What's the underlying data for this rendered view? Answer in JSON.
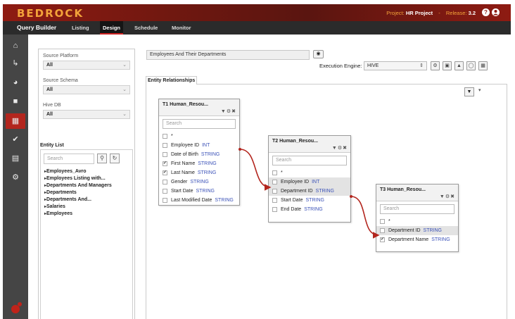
{
  "header": {
    "brand": "BEDROCK",
    "project_label": "Project:",
    "project_value": "HR Project",
    "separator": "-",
    "release_label": "Release:",
    "release_value": "3.2",
    "help_icon": "?",
    "user_icon": "user-icon"
  },
  "nav": {
    "title": "Query Builder",
    "tabs": [
      "Listing",
      "Design",
      "Schedule",
      "Monitor"
    ],
    "active": "Design"
  },
  "sidebar": {
    "icons": [
      "home-icon",
      "lineage-icon",
      "dashboard-icon",
      "folder-icon",
      "grid-icon",
      "check-icon",
      "clipboard-icon",
      "gear-icon",
      "logo-icon"
    ],
    "active": "grid-icon"
  },
  "filters": {
    "source_platform_label": "Source Platform",
    "source_platform_value": "All",
    "source_schema_label": "Source Schema",
    "source_schema_value": "All",
    "hive_db_label": "Hive DB",
    "hive_db_value": "All"
  },
  "entity_list": {
    "title": "Entity List",
    "search_placeholder": "Search",
    "items": [
      "Employees_Avro",
      "Employees Listing with...",
      "Departments And Managers",
      "Departments",
      "Departments And...",
      "Salaries",
      "Employees"
    ]
  },
  "query": {
    "name": "Employees And Their Departments",
    "exec_label": "Execution Engine:",
    "exec_value": "HIVE"
  },
  "er_tab": "Entity Relationships",
  "tables": [
    {
      "title": "T1  Human_Resou...",
      "search_placeholder": "Search",
      "columns": [
        {
          "name": "*",
          "type": "",
          "checked": false,
          "highlight": false
        },
        {
          "name": "Employee ID",
          "type": "INT",
          "checked": false,
          "highlight": false
        },
        {
          "name": "Date of Birth",
          "type": "STRING",
          "checked": false,
          "highlight": false
        },
        {
          "name": "First Name",
          "type": "STRING",
          "checked": true,
          "highlight": false
        },
        {
          "name": "Last Name",
          "type": "STRING",
          "checked": true,
          "highlight": false
        },
        {
          "name": "Gender",
          "type": "STRING",
          "checked": false,
          "highlight": false
        },
        {
          "name": "Start Date",
          "type": "STRING",
          "checked": false,
          "highlight": false
        },
        {
          "name": "Last Modified Date",
          "type": "STRING",
          "checked": false,
          "highlight": false
        }
      ]
    },
    {
      "title": "T2  Human_Resou...",
      "search_placeholder": "Search",
      "columns": [
        {
          "name": "*",
          "type": "",
          "checked": false,
          "highlight": false
        },
        {
          "name": "Employee ID",
          "type": "INT",
          "checked": false,
          "highlight": true
        },
        {
          "name": "Department ID",
          "type": "STRING",
          "checked": false,
          "highlight": true
        },
        {
          "name": "Start Date",
          "type": "STRING",
          "checked": false,
          "highlight": false
        },
        {
          "name": "End Date",
          "type": "STRING",
          "checked": false,
          "highlight": false
        }
      ]
    },
    {
      "title": "T3  Human_Resou...",
      "search_placeholder": "Search",
      "columns": [
        {
          "name": "*",
          "type": "",
          "checked": false,
          "highlight": false
        },
        {
          "name": "Department ID",
          "type": "STRING",
          "checked": false,
          "highlight": true
        },
        {
          "name": "Department Name",
          "type": "STRING",
          "checked": true,
          "highlight": false
        }
      ]
    }
  ],
  "colors": {
    "brand_red": "#8e1b12",
    "accent_orange": "#f3a33a",
    "link_red": "#b3261e",
    "type_blue": "#3b52b8"
  }
}
